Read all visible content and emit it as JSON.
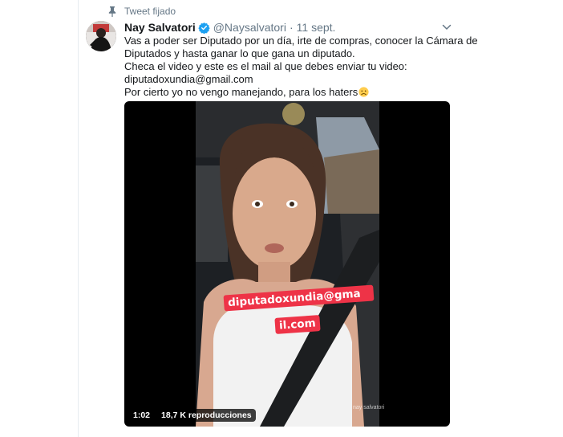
{
  "pinned": {
    "label": "Tweet fijado",
    "icon": "pin-icon"
  },
  "author": {
    "display_name": "Nay Salvatori",
    "verified_icon": "verified-badge-icon",
    "handle": "@Naysalvatori",
    "separator": "·",
    "date": "11 sept."
  },
  "menu_icon": "chevron-down-icon",
  "tweet": {
    "lines": [
      "Vas a poder ser Diputado por un día, irte de compras, conocer la Cámara de",
      "Diputados y hasta ganar lo que gana un diputado.",
      "Checa el video y este es el mail al que debes enviar tu video:",
      "diputadoxundia@gmail.com",
      "Por cierto yo no vengo manejando, para los haters"
    ],
    "emoji": "worried-face-emoji"
  },
  "video": {
    "overlay_line1": "diputadoxundia@gma",
    "overlay_line2": "il.com",
    "watermark": "nay salvatori",
    "duration": "1:02",
    "views": "18,7 K reproducciones"
  },
  "colors": {
    "accent": "#1da1f2",
    "sticker": "#ee3347",
    "muted": "#657786"
  }
}
